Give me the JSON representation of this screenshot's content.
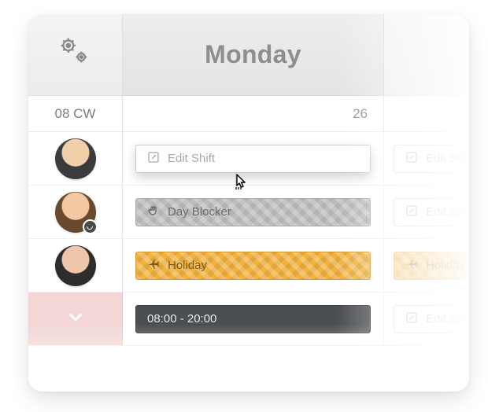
{
  "header": {
    "day_label": "Monday",
    "week_label": "08 CW",
    "day_number": "26"
  },
  "rows": [
    {
      "type": "edit",
      "main_label": "Edit Shift",
      "ghost_label": "Edit Shift"
    },
    {
      "type": "blocker",
      "main_label": "Day Blocker",
      "ghost_label": "Edit Shift"
    },
    {
      "type": "holiday",
      "main_label": "Holiday",
      "holiday_ghost_label": "Holiday"
    },
    {
      "type": "slot",
      "main_label": "08:00 - 20:00",
      "ghost_label": "Edit Shift"
    }
  ],
  "icons": {
    "settings": "gear-icon",
    "edit": "edit-icon",
    "hand": "hand-icon",
    "plane": "plane-icon",
    "chevron": "chevron-down-icon"
  },
  "colors": {
    "holiday": "#f2b33e",
    "blocker": "#bdbdbd",
    "slot": "#4b4e52",
    "expand_bg": "#f3d6d6"
  }
}
